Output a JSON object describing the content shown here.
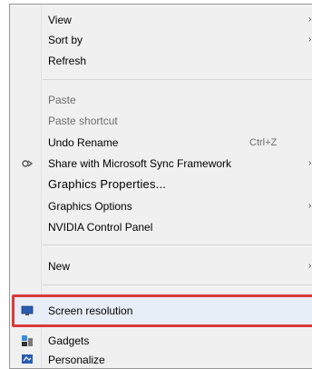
{
  "menu": {
    "items": [
      {
        "label": "View",
        "arrow": "›"
      },
      {
        "label": "Sort by",
        "arrow": "›"
      },
      {
        "label": "Refresh"
      },
      {
        "label": "Paste"
      },
      {
        "label": "Paste shortcut"
      },
      {
        "label": "Undo Rename",
        "shortcut": "Ctrl+Z"
      },
      {
        "label": "Share with Microsoft Sync Framework",
        "arrow": "›"
      },
      {
        "label": "Graphics Properties..."
      },
      {
        "label": "Graphics Options",
        "arrow": "›"
      },
      {
        "label": "NVIDIA Control Panel"
      },
      {
        "label": "New",
        "arrow": "›"
      },
      {
        "label": "Screen resolution"
      },
      {
        "label": "Gadgets"
      },
      {
        "label": "Personalize"
      }
    ]
  },
  "colors": {
    "menu_bg": "#f0f0f0",
    "highlight_border": "#d93a3a",
    "screen_icon": "#2a5db0"
  }
}
